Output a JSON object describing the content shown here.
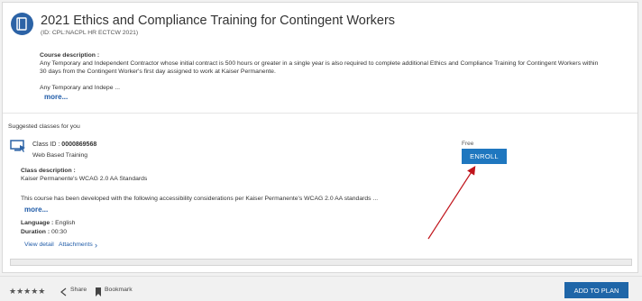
{
  "course": {
    "title": "2021 Ethics and Compliance Training for Contingent Workers",
    "code": "(ID: CPL:NACPL HR ECTCW 2021)",
    "description_label": "Course description :",
    "description_text": "Any Temporary and Independent Contractor whose initial contract is 500 hours or greater in a single year is also required to complete additional Ethics and Compliance Training for Contingent Workers within 30 days from the Contingent Worker's first day assigned to work at Kaiser Permanente.",
    "description_short": "Any Temporary and Indepe ...",
    "more_label": "more..."
  },
  "suggested": {
    "heading": "Suggested classes for you",
    "class_id_label": "Class ID :",
    "class_id": "0000869568",
    "class_type": "Web Based Training",
    "price": "Free",
    "enroll_label": "ENROLL",
    "class_desc_label": "Class description :",
    "class_desc_text": "Kaiser Permanente's WCAG 2.0 AA Standards",
    "class_desc_short": "This course has been developed with the following accessibility considerations per Kaiser Permanente's WCAG 2.0 AA standards ...",
    "more_label": "more...",
    "language_label": "Language :",
    "language": "English",
    "duration_label": "Duration :",
    "duration": "00:30",
    "view_detail": "View detail",
    "attachments": "Attachments"
  },
  "footer": {
    "stars": "★★★★★",
    "share_label": "Share",
    "bookmark_label": "Bookmark",
    "add_to_plan_label": "ADD TO PLAN"
  },
  "icons": {
    "course": "book-icon",
    "class": "monitor-icon",
    "share": "share-icon",
    "bookmark": "bookmark-icon",
    "chevron": "chevron-right-icon"
  },
  "colors": {
    "accent": "#1f77bf",
    "link": "#1f5ba8",
    "annotation_arrow": "#c0141b"
  }
}
